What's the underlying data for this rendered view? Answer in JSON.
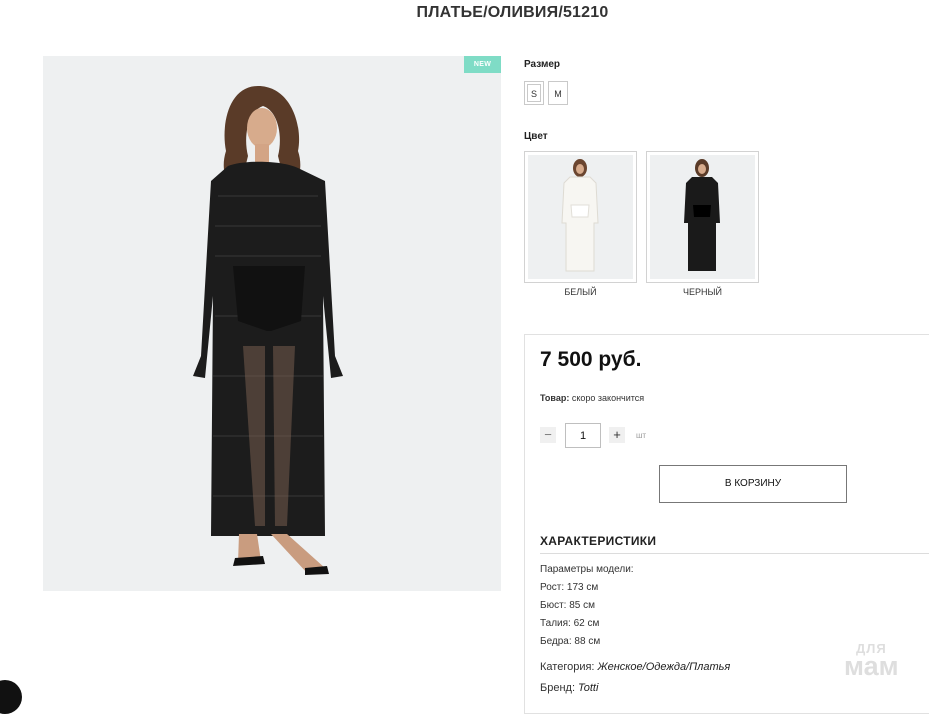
{
  "product": {
    "title": "ПЛАТЬЕ/ОЛИВИЯ/51210",
    "badge": "NEW",
    "photo_alt_icon": "model-photo"
  },
  "size": {
    "label": "Размер",
    "options": [
      "S",
      "M"
    ],
    "selected": "S"
  },
  "color": {
    "label": "Цвет",
    "options": [
      {
        "name": "БЕЛЫЙ",
        "dress_color": "#f4f2ee"
      },
      {
        "name": "ЧЕРНЫЙ",
        "dress_color": "#1a1a1a"
      }
    ]
  },
  "purchase": {
    "price": "7 500 руб.",
    "stock_label": "Товар:",
    "stock_value": "скоро закончится",
    "qty_minus": "−",
    "qty_plus": "+",
    "qty_value": "1",
    "unit": "шт",
    "cart_button": "В КОРЗИНУ"
  },
  "characteristics": {
    "title": "ХАРАКТЕРИСТИКИ",
    "lines": [
      "Параметры модели:",
      "Рост: 173 см",
      "Бюст: 85 см",
      "Талия: 62 см",
      "Бедра: 88 см"
    ],
    "category_label": "Категория:",
    "category_value": "Женское/Одежда/Платья",
    "brand_label": "Бренд:",
    "brand_value": "Totti"
  },
  "watermark": {
    "line1": "ДЛЯ",
    "line2": "мам"
  },
  "colors": {
    "badge": "#7fdcc6",
    "photo_bg": "#eef0f1"
  }
}
